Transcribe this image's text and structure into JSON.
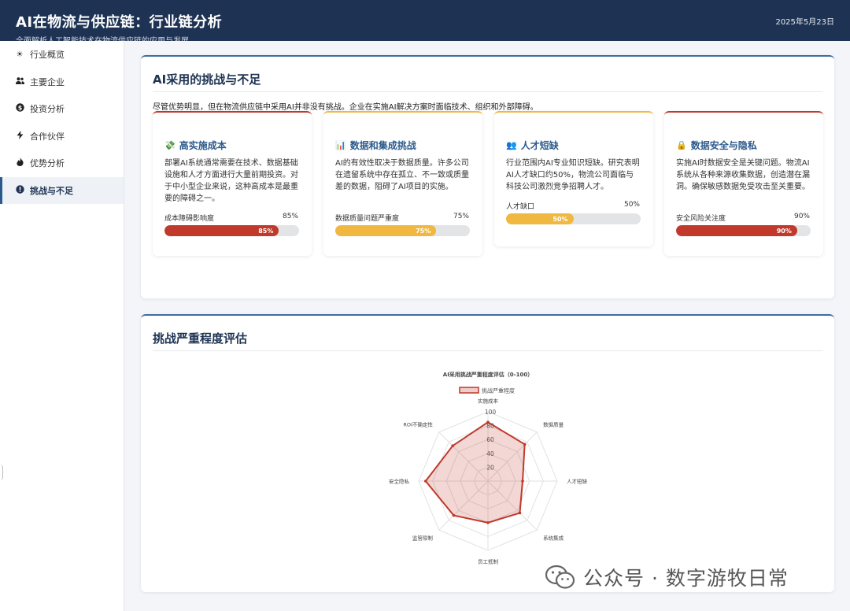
{
  "header": {
    "title": "AI在物流与供应链：行业链分析",
    "subtitle": "全面解析人工智能技术在物流供应链的应用与发展",
    "date": "2025年5月23日"
  },
  "sidebar": {
    "items": [
      {
        "label": "行业概览",
        "icon": "sun-icon",
        "glyph": "☀"
      },
      {
        "label": "主要企业",
        "icon": "users-icon",
        "glyph": "👥"
      },
      {
        "label": "投资分析",
        "icon": "dollar-icon",
        "glyph": "$"
      },
      {
        "label": "合作伙伴",
        "icon": "bolt-icon",
        "glyph": "⚡"
      },
      {
        "label": "优势分析",
        "icon": "flame-icon",
        "glyph": "🔥"
      },
      {
        "label": "挑战与不足",
        "icon": "alert-icon",
        "glyph": "!"
      }
    ],
    "active_index": 5
  },
  "challenges": {
    "title": "AI采用的挑战与不足",
    "intro": "尽管优势明显，但在物流供应链中采用AI并非没有挑战。企业在实施AI解决方案时面临技术、组织和外部障碍。",
    "cards": [
      {
        "title": "高实施成本",
        "emoji": "💸",
        "desc": "部署AI系统通常需要在技术、数据基础设施和人才方面进行大量前期投资。对于中小型企业来说，这种高成本是最重要的障碍之一。",
        "metric_label": "成本障碍影响度",
        "metric_value": "85%",
        "value": 85,
        "bar_text": "85%",
        "color": "#c0392b"
      },
      {
        "title": "数据和集成挑战",
        "emoji": "📊",
        "desc": "AI的有效性取决于数据质量。许多公司在遗留系统中存在孤立、不一致或质量差的数据，阻碍了AI项目的实施。",
        "metric_label": "数据质量问题严重度",
        "metric_value": "75%",
        "value": 75,
        "bar_text": "75%",
        "color": "#f0b840"
      },
      {
        "title": "人才短缺",
        "emoji": "👥",
        "desc": "行业范围内AI专业知识短缺。研究表明AI人才缺口约50%，物流公司面临与科技公司激烈竞争招聘人才。",
        "metric_label": "人才缺口",
        "metric_value": "50%",
        "value": 50,
        "bar_text": "50%",
        "color": "#f0b840"
      },
      {
        "title": "数据安全与隐私",
        "emoji": "🔒",
        "desc": "实施AI时数据安全是关键问题。物流AI系统从各种来源收集数据，创造潜在漏洞。确保敏感数据免受攻击至关重要。",
        "metric_label": "安全风险关注度",
        "metric_value": "90%",
        "value": 90,
        "bar_text": "90%",
        "color": "#c0392b"
      }
    ]
  },
  "severity": {
    "title": "挑战严重程度评估"
  },
  "chart_data": {
    "type": "radar",
    "title": "AI采用挑战严重程度评估（0-100）",
    "categories": [
      "实施成本",
      "数据质量",
      "人才短缺",
      "系统集成",
      "员工抵制",
      "监管限制",
      "安全隐私",
      "ROI不确定性"
    ],
    "series": [
      {
        "name": "挑战严重程度",
        "values": [
          85,
          75,
          50,
          65,
          60,
          70,
          90,
          72
        ],
        "color": "#c0392b"
      }
    ],
    "rlim": [
      0,
      100
    ],
    "ticks": [
      "20",
      "40",
      "60",
      "80",
      "100"
    ],
    "legend": "top"
  },
  "watermark": {
    "text": "公众号 · 数字游牧日常"
  }
}
